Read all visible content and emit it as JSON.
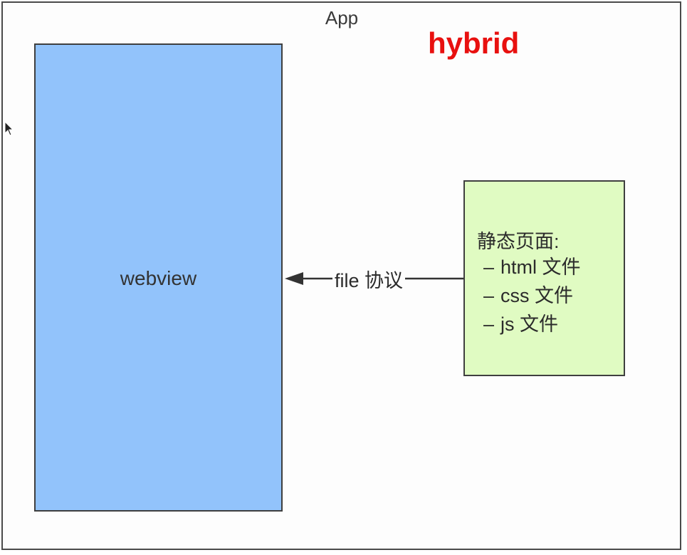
{
  "app": {
    "label": "App"
  },
  "title": "hybrid",
  "webview": {
    "label": "webview"
  },
  "static_pages": {
    "title": "静态页面:",
    "items": [
      {
        "dash": "–",
        "text": "html 文件"
      },
      {
        "dash": "–",
        "text": "css 文件"
      },
      {
        "dash": "–",
        "text": "js 文件"
      }
    ]
  },
  "connector": {
    "label": "file 协议"
  },
  "colors": {
    "title": "#e8100f",
    "webview_fill": "#92c3fb",
    "static_fill": "#e0fbc2",
    "border": "#3f3f3f"
  }
}
